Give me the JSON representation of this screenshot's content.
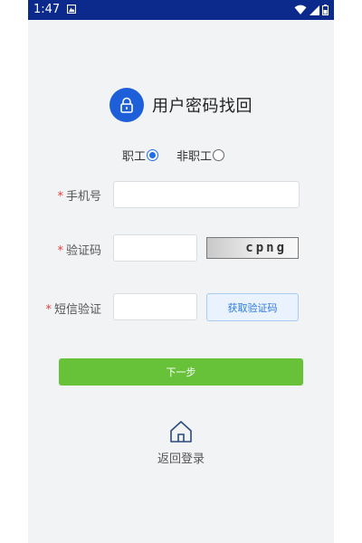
{
  "status_bar": {
    "time": "1:47",
    "icons": [
      "notification-icon",
      "wifi-icon",
      "signal-icon",
      "battery-icon"
    ]
  },
  "title": {
    "text": "用户密码找回",
    "icon": "lock-icon"
  },
  "user_type": {
    "options": [
      {
        "label": "职工",
        "checked": true
      },
      {
        "label": "非职工",
        "checked": false
      }
    ]
  },
  "form": {
    "required_mark": "*",
    "phone_label": "手机号",
    "captcha_label": "验证码",
    "captcha_text": "cpng",
    "sms_label": "短信验证",
    "sms_button": "获取验证码"
  },
  "next_button": "下一步",
  "back_home": {
    "label": "返回登录",
    "icon": "home-icon"
  },
  "colors": {
    "status_bar": "#0b2a8c",
    "accent": "#1d5fd8",
    "primary_green": "#67c23a",
    "required": "#e0443c"
  }
}
